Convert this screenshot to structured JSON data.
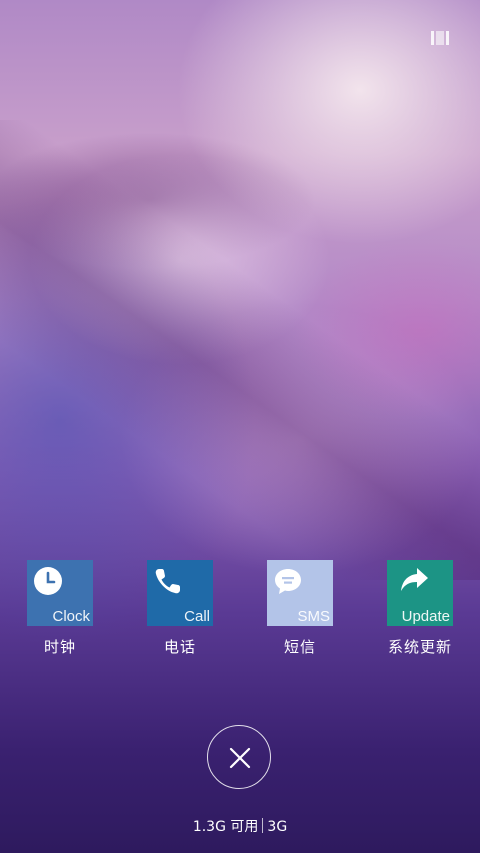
{
  "apps": [
    {
      "name": "时钟",
      "tile_label": "Clock",
      "icon": "clock-icon",
      "color": "#3d72b0"
    },
    {
      "name": "电话",
      "tile_label": "Call",
      "icon": "phone-icon",
      "color": "#1f6aa8"
    },
    {
      "name": "短信",
      "tile_label": "SMS",
      "icon": "message-icon",
      "color": "#b3c4e8"
    },
    {
      "name": "系统更新",
      "tile_label": "Update",
      "icon": "share-arrow-icon",
      "color": "#1c9485"
    }
  ],
  "memory": {
    "available": "1.3G 可用",
    "total": "3G"
  },
  "close_icon": "close-icon",
  "top_right_icon": "recent-apps-icon"
}
